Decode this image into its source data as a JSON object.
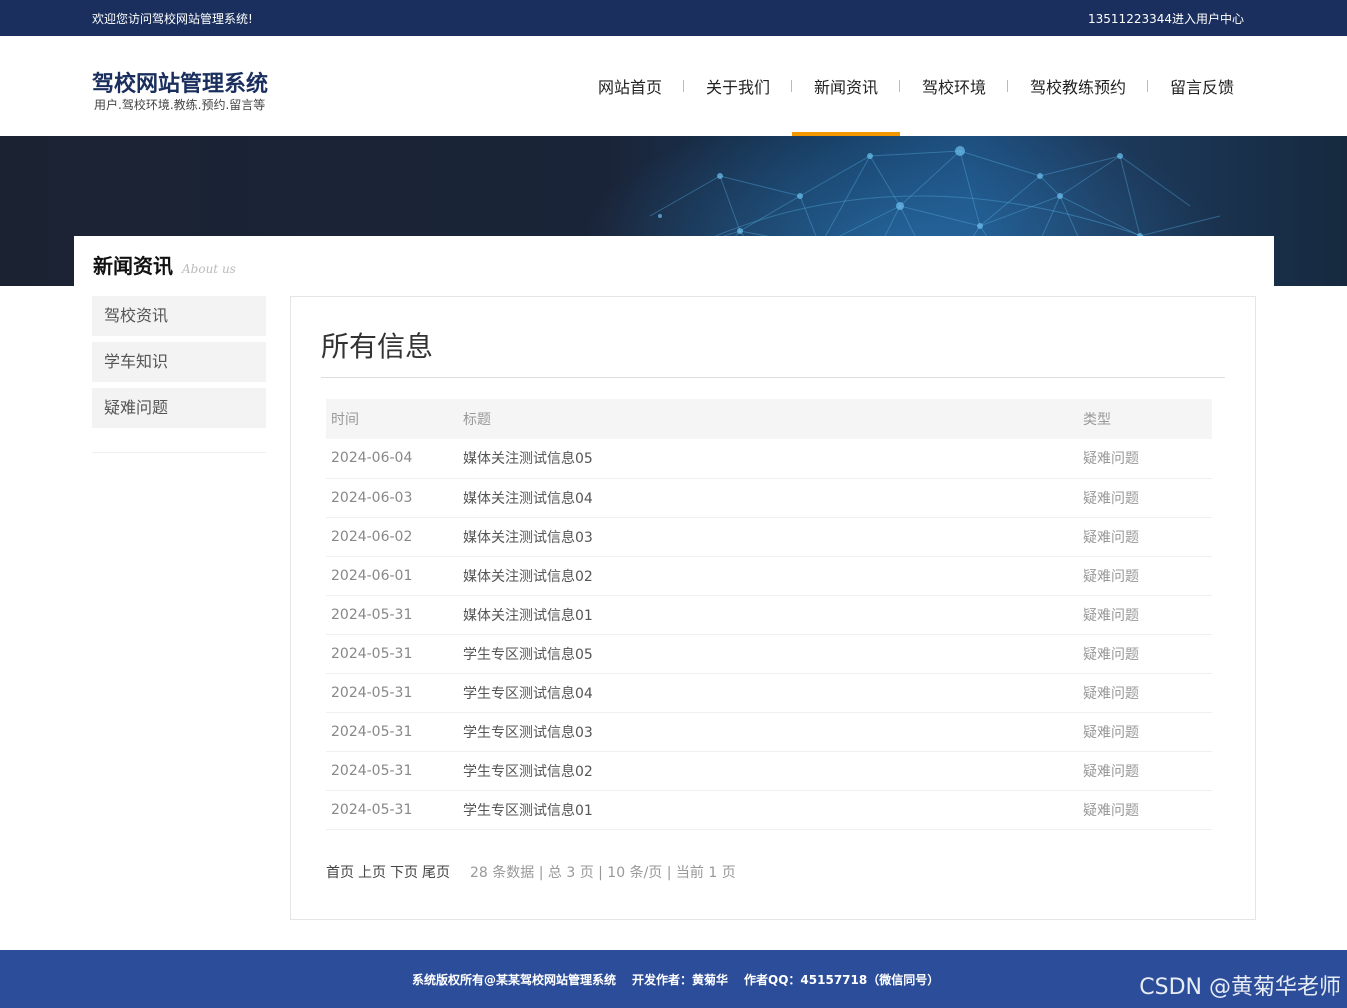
{
  "topbar": {
    "welcome": "欢迎您访问驾校网站管理系统!",
    "user_link": "13511223344进入用户中心"
  },
  "brand": {
    "title": "驾校网站管理系统",
    "subtitle": "用户.驾校环境.教练.预约.留言等"
  },
  "nav": {
    "items": [
      {
        "label": "网站首页"
      },
      {
        "label": "关于我们"
      },
      {
        "label": "新闻资讯"
      },
      {
        "label": "驾校环境"
      },
      {
        "label": "驾校教练预约"
      },
      {
        "label": "留言反馈"
      }
    ],
    "active_index": 2
  },
  "page_head": {
    "title": "新闻资讯",
    "subtitle": "About us"
  },
  "sidebar": {
    "items": [
      {
        "label": "驾校资讯"
      },
      {
        "label": "学车知识"
      },
      {
        "label": "疑难问题"
      }
    ]
  },
  "main": {
    "title": "所有信息",
    "columns": [
      "时间",
      "标题",
      "类型"
    ],
    "rows": [
      {
        "date": "2024-06-04",
        "title": "媒体关注测试信息05",
        "type": "疑难问题"
      },
      {
        "date": "2024-06-03",
        "title": "媒体关注测试信息04",
        "type": "疑难问题"
      },
      {
        "date": "2024-06-02",
        "title": "媒体关注测试信息03",
        "type": "疑难问题"
      },
      {
        "date": "2024-06-01",
        "title": "媒体关注测试信息02",
        "type": "疑难问题"
      },
      {
        "date": "2024-05-31",
        "title": "媒体关注测试信息01",
        "type": "疑难问题"
      },
      {
        "date": "2024-05-31",
        "title": "学生专区测试信息05",
        "type": "疑难问题"
      },
      {
        "date": "2024-05-31",
        "title": "学生专区测试信息04",
        "type": "疑难问题"
      },
      {
        "date": "2024-05-31",
        "title": "学生专区测试信息03",
        "type": "疑难问题"
      },
      {
        "date": "2024-05-31",
        "title": "学生专区测试信息02",
        "type": "疑难问题"
      },
      {
        "date": "2024-05-31",
        "title": "学生专区测试信息01",
        "type": "疑难问题"
      }
    ]
  },
  "pager": {
    "first": "首页",
    "prev": "上页",
    "next": "下页",
    "last": "尾页",
    "info": "28 条数据 | 总 3 页 | 10 条/页 | 当前 1 页"
  },
  "footer": {
    "copyright": "系统版权所有@某某驾校网站管理系统",
    "author": "开发作者：黄菊华",
    "qq": "作者QQ：45157718（微信同号）"
  },
  "watermark": "CSDN @黄菊华老师",
  "colors": {
    "topbar": "#1a2f5e",
    "accent": "#f39800",
    "footer": "#2c4e9a"
  }
}
